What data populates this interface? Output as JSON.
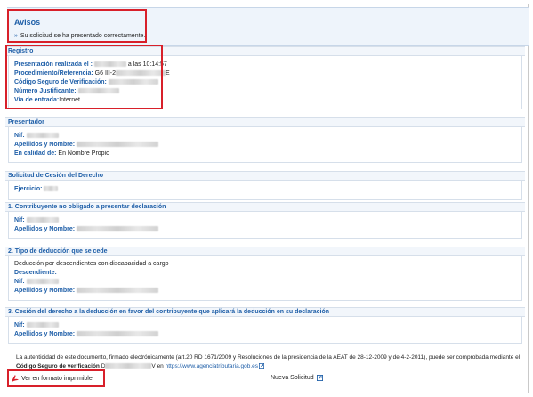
{
  "avisos": {
    "title": "Avisos",
    "message": "Su solicitud se ha presentado correctamente."
  },
  "registro": {
    "title": "Registro",
    "rows": [
      {
        "label": "Presentación realizada el :",
        "value": "a las 10:14:57"
      },
      {
        "label": "Procedimiento/Referencia:",
        "value": "G6 III-2",
        "suffix": "E"
      },
      {
        "label": "Código Seguro de Verificación:",
        "value": ""
      },
      {
        "label": "Número Justificante:",
        "value": ""
      },
      {
        "label": "Vía de entrada:",
        "value": "Internet"
      }
    ]
  },
  "presentador": {
    "title": "Presentador",
    "rows": [
      {
        "label": "Nif:",
        "value": ""
      },
      {
        "label": "Apellidos y Nombre:",
        "value": ""
      },
      {
        "label": "En calidad de:",
        "value": "En Nombre Propio"
      }
    ]
  },
  "solicitud": {
    "title": "Solicitud de Cesión del Derecho",
    "rows": [
      {
        "label": "Ejercicio:",
        "value": ""
      }
    ]
  },
  "contribuyente": {
    "title": "1. Contribuyente no obligado a presentar declaración",
    "rows": [
      {
        "label": "Nif:",
        "value": ""
      },
      {
        "label": "Apellidos y Nombre:",
        "value": ""
      }
    ]
  },
  "deduccion": {
    "title": "2. Tipo de deducción que se cede",
    "description": "Deducción por descendientes con discapacidad a cargo",
    "subtitle": "Descendiente:",
    "rows": [
      {
        "label": "Nif:",
        "value": ""
      },
      {
        "label": "Apellidos y Nombre:",
        "value": ""
      }
    ]
  },
  "cesion": {
    "title": "3. Cesión del derecho a la deducción en favor del contribuyente que aplicará la deducción en su declaración",
    "rows": [
      {
        "label": "Nif:",
        "value": ""
      },
      {
        "label": "Apellidos y Nombre:",
        "value": ""
      }
    ]
  },
  "footer": {
    "text": "La autenticidad de este documento, firmado electrónicamente (art.20 RD 1671/2009 y Resoluciones de la presidencia de la AEAT de 28-12-2009 y de 4-2-2011), puede ser comprobada mediante el",
    "csv_label": "Código Seguro de verificación",
    "csv_prefix": "D",
    "csv_suffix": "V en",
    "link": "https://www.agenciatributaria.gob.es",
    "print_label": "Ver en formato imprimible",
    "nueva_label": "Nueva Solicitud"
  },
  "colors": {
    "accent": "#1f5fa8",
    "highlight": "#d8202a"
  }
}
